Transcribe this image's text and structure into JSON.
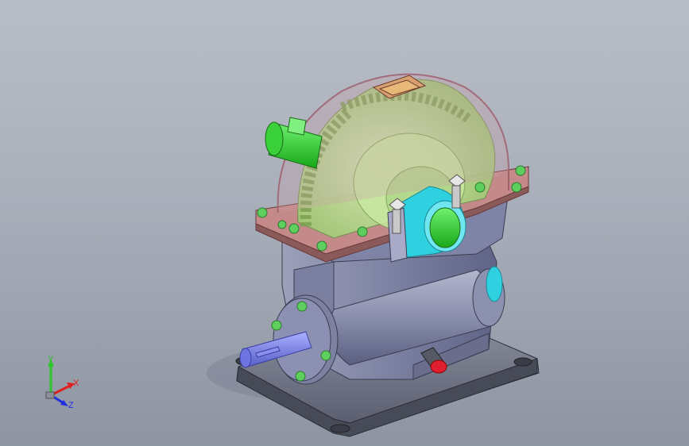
{
  "viewport": {
    "background_top": "#b9bdc6",
    "background_bottom": "#8e95a2"
  },
  "model": {
    "base_color": "#5e6270",
    "housing_color": "#8a8fb0",
    "gear_color": "#b8e08c",
    "cover_color": "#c98a8a",
    "input_shaft_color": "#3ad13a",
    "output_shaft_color": "#7f86e6",
    "bearing_cap_color": "#2fd0e0",
    "bolt_color": "#5ecf5e",
    "plug_color": "#e02030"
  },
  "triad": {
    "y_label": "Y",
    "x_label": "X",
    "z_label": "Z",
    "y_color": "#2cc52c",
    "x_color": "#e02020",
    "z_color": "#2030e0"
  }
}
